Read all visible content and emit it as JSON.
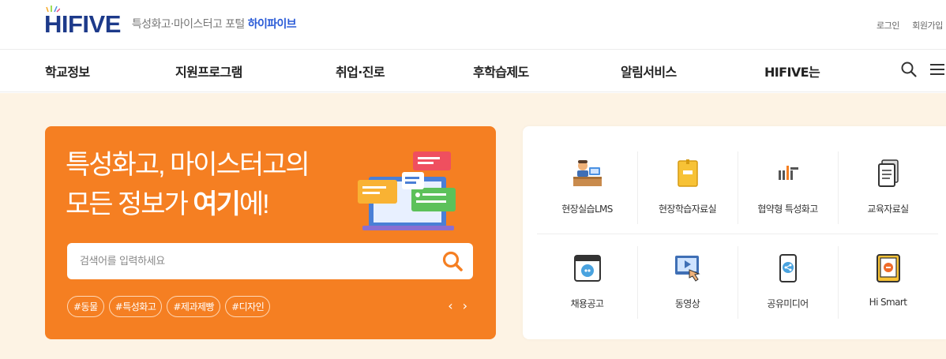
{
  "brand": {
    "logo_text": "HIFIVE",
    "tagline": "특성화고·마이스터고 포털",
    "tagline_strong": "하이파이브"
  },
  "util": {
    "login": "로그인",
    "signup": "회원가입"
  },
  "nav": {
    "items": [
      {
        "label": "학교정보"
      },
      {
        "label": "지원프로그램"
      },
      {
        "label": "취업·진로"
      },
      {
        "label": "후학습제도"
      },
      {
        "label": "알림서비스"
      },
      {
        "label": "HIFIVE는"
      }
    ],
    "search_icon": "search-icon",
    "menu_icon": "hamburger-menu-icon"
  },
  "banner": {
    "headline_line1": "특성화고, 마이스터고의",
    "headline_line2_a": "모든 정보가 ",
    "headline_line2_b": "여기",
    "headline_line2_c": "에!",
    "search_placeholder": "검색어를 입력하세요",
    "tags": [
      "#동물",
      "#특성화고",
      "#제과제빵",
      "#디자인"
    ],
    "prev": "‹",
    "next": "›",
    "color": "#f57f22"
  },
  "quick_links": {
    "row1": [
      {
        "label": "현장실습LMS",
        "icon": "worker-desk-icon"
      },
      {
        "label": "현장학습자료실",
        "icon": "folder-icon"
      },
      {
        "label": "협약형 특성화고",
        "icon": "chart-bars-icon"
      },
      {
        "label": "교육자료실",
        "icon": "document-icon"
      }
    ],
    "row2": [
      {
        "label": "채용공고",
        "icon": "job-search-icon"
      },
      {
        "label": "동영상",
        "icon": "video-touch-icon"
      },
      {
        "label": "공유미디어",
        "icon": "share-phone-icon"
      },
      {
        "label": "Hi Smart",
        "icon": "tablet-icon"
      }
    ]
  }
}
